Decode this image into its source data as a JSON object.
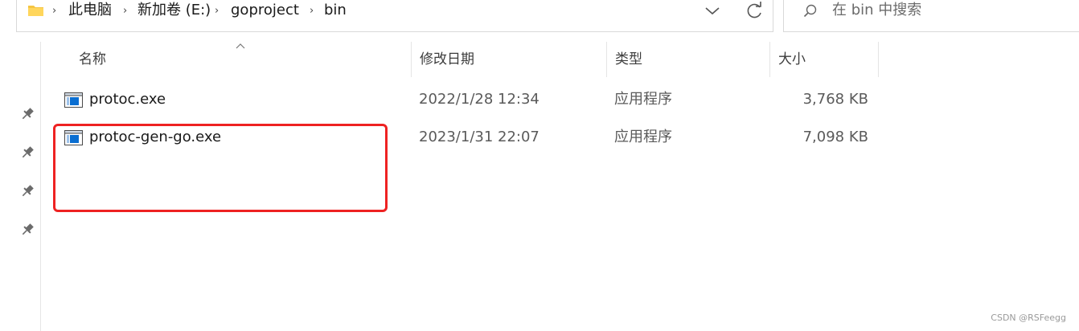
{
  "address_bar": {
    "breadcrumbs": [
      "此电脑",
      "新加卷 (E:)",
      "goproject",
      "bin"
    ],
    "separator": "›"
  },
  "search": {
    "placeholder": "在 bin 中搜索"
  },
  "columns": {
    "name": "名称",
    "date_modified": "修改日期",
    "type": "类型",
    "size": "大小"
  },
  "files": [
    {
      "name": "protoc.exe",
      "date_modified": "2022/1/28 12:34",
      "type": "应用程序",
      "size": "3,768 KB"
    },
    {
      "name": "protoc-gen-go.exe",
      "date_modified": "2023/1/31 22:07",
      "type": "应用程序",
      "size": "7,098 KB"
    }
  ],
  "watermark": "CSDN @RSFeegg",
  "colors": {
    "highlight": "#ee2222",
    "folder": "#f5c542",
    "exe_blue": "#0a6ed1"
  }
}
